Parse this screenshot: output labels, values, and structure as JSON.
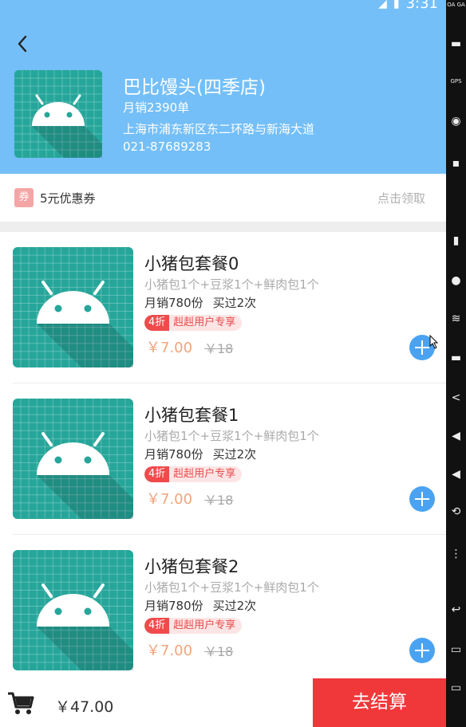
{
  "status_bar": {
    "time": "3:31"
  },
  "store": {
    "name": "巴比馒头(四季店)",
    "monthly_sales": "月销2390单",
    "address": "上海市浦东新区东二环路与新海大道",
    "phone": "021-87689283"
  },
  "coupon": {
    "icon_label": "券",
    "title": "5元优惠券",
    "action": "点击领取"
  },
  "products": [
    {
      "name": "小猪包套餐0",
      "desc": "小猪包1个+豆浆1个+鲜肉包1个",
      "sales": "月销780份",
      "limit": "买过2次",
      "discount": "4折",
      "promo": "赳赳用户专享",
      "price": "￥7.00",
      "original_price": "￥18"
    },
    {
      "name": "小猪包套餐1",
      "desc": "小猪包1个+豆浆1个+鲜肉包1个",
      "sales": "月销780份",
      "limit": "买过2次",
      "discount": "4折",
      "promo": "赳赳用户专享",
      "price": "￥7.00",
      "original_price": "￥18"
    },
    {
      "name": "小猪包套餐2",
      "desc": "小猪包1个+豆浆1个+鲜肉包1个",
      "sales": "月销780份",
      "limit": "买过2次",
      "discount": "4折",
      "promo": "赳赳用户专享",
      "price": "￥7.00",
      "original_price": "￥18"
    }
  ],
  "cart": {
    "total": "￥47.00",
    "checkout_label": "去结算"
  },
  "side_toolbar": {
    "labels": [
      "OA GA",
      "GPS"
    ]
  },
  "colors": {
    "header_bg": "#74bff8",
    "accent_red": "#f0373a",
    "add_button": "#4aa3f2",
    "price": "#f0a47c",
    "tile": "#26a69a"
  }
}
